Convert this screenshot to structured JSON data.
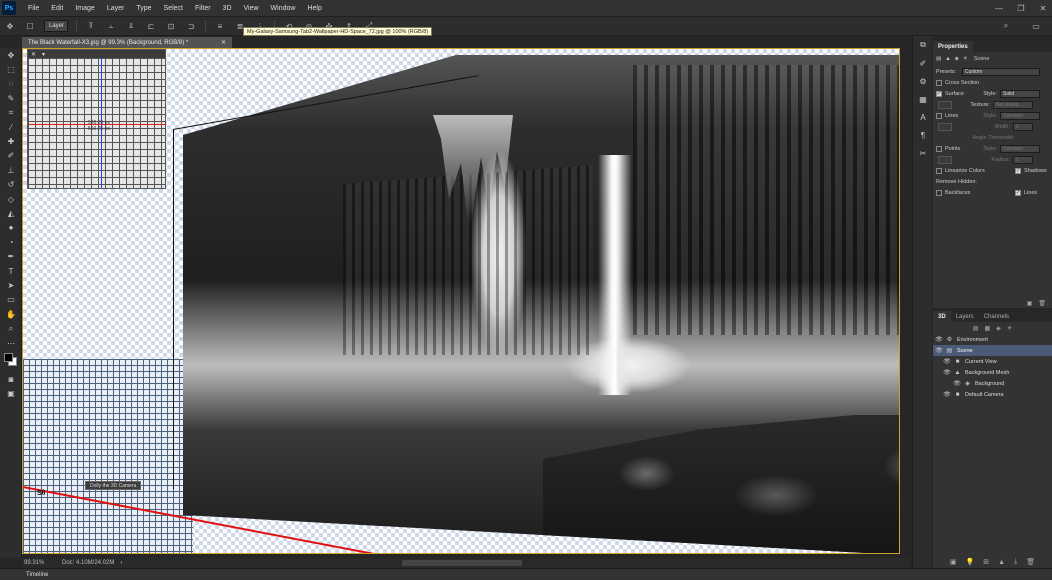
{
  "menu": [
    "File",
    "Edit",
    "Image",
    "Layer",
    "Type",
    "Select",
    "Filter",
    "3D",
    "View",
    "Window",
    "Help"
  ],
  "app_logo": "Ps",
  "window_controls": [
    "—",
    "❐",
    "✕"
  ],
  "options": {
    "layer_select": "Layer"
  },
  "tab": {
    "title": "The Black Waterfall-X3.jpg @ 99.3% (Background, RGB/8) *",
    "close": "✕"
  },
  "tooltip": "My-Galaxy-Samsung-Tab2-Wallpaper-HD-Space_72.jpg @ 100% (RGB/8)",
  "navigator": {
    "label_1": "560.25 px",
    "label_2": "560.25 px"
  },
  "canvas_hint": "Dolly the 3D Camera",
  "axis_label": "Sθ",
  "status": {
    "zoom": "99.31%",
    "doc": "Doc: 4.10M/24.02M"
  },
  "timeline_label": "Timeline",
  "properties": {
    "tabs": [
      "Properties"
    ],
    "scene_label": "Scene",
    "presets_label": "Presets:",
    "presets_value": "Custom",
    "cross_section": "Cross Section",
    "surface": "Surface",
    "surface_style_label": "Style:",
    "surface_style_value": "Solid",
    "texture_label": "Texture:",
    "texture_value": "Not Availa...",
    "lines": "Lines",
    "lines_style_label": "Style:",
    "lines_style_value": "Constant",
    "width_label": "Width:",
    "width_value": "1",
    "angle_label": "Angle Threshold:",
    "points": "Points",
    "points_style_label": "Style:",
    "points_style_value": "Constant",
    "radius_label": "Radius:",
    "radius_value": "1",
    "linearize": "Linearize Colors",
    "shadows": "Shadows",
    "remove_hidden": "Remove Hidden:",
    "backfaces": "Backfaces",
    "lines_chk": "Lines"
  },
  "layers_panel": {
    "tabs": [
      "3D",
      "Layers",
      "Channels"
    ],
    "rows": [
      {
        "name": "Environment",
        "icon": "⚙"
      },
      {
        "name": "Scene",
        "icon": "▤"
      },
      {
        "name": "Current View",
        "icon": "■"
      },
      {
        "name": "Background Mesh",
        "icon": "▲"
      },
      {
        "name": "Background",
        "icon": "◈"
      },
      {
        "name": "Default Camera",
        "icon": "■"
      }
    ]
  },
  "colors": {
    "accent": "#caa12b",
    "selection": "#4a5a78",
    "red_axis": "#e01010",
    "blue_axis": "#2040ff"
  }
}
